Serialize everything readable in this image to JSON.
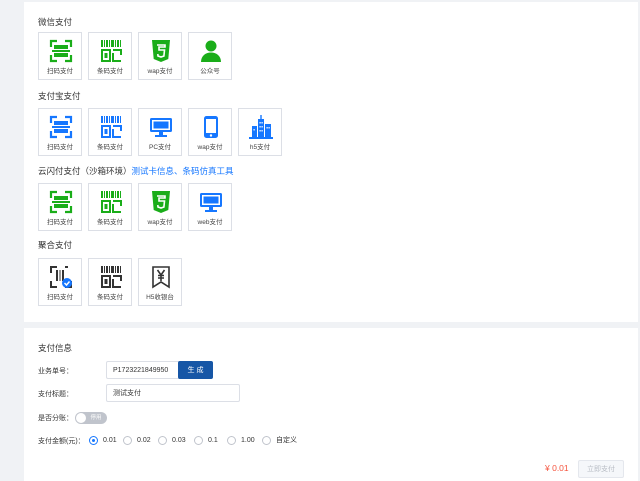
{
  "sections": {
    "wechat": {
      "title": "微信支付",
      "tiles": [
        "扫码支付",
        "条码支付",
        "wap支付",
        "公众号"
      ]
    },
    "alipay": {
      "title": "支付宝支付",
      "tiles": [
        "扫码支付",
        "条码支付",
        "PC支付",
        "wap支付",
        "h5支付"
      ]
    },
    "unionpay": {
      "title": "云闪付支付（沙箱环境）",
      "links": "测试卡信息、条码仿真工具",
      "tiles": [
        "扫码支付",
        "条码支付",
        "wap支付",
        "web支付"
      ]
    },
    "aggregate": {
      "title": "聚合支付",
      "tiles": [
        "扫码支付",
        "条码支付",
        "H5收银台"
      ]
    }
  },
  "icons": {
    "wechat": [
      "scan-icon",
      "barcode-icon",
      "html5-icon",
      "user-icon"
    ],
    "alipay": [
      "scan-icon",
      "barcode-icon",
      "monitor-icon",
      "phone-icon",
      "building-icon"
    ],
    "unionpay": [
      "scan-icon",
      "barcode-icon",
      "html5-icon",
      "monitor-icon"
    ],
    "aggregate": [
      "scan-check-icon",
      "barcode-icon",
      "yen-icon"
    ]
  },
  "colors": {
    "wechat": "#1aad19",
    "alipay": "#1677ff",
    "aggregate": "#333333",
    "price": "#f5533d",
    "primary_button": "#1656a6"
  },
  "pay_info": {
    "title": "支付信息",
    "order_label": "业务单号：",
    "order_value": "P1723221849950",
    "generate_label": "生 成",
    "subject_label": "支付标题：",
    "subject_value": "测试支付",
    "split_label": "是否分账：",
    "split_toggle": "停用",
    "amount_label": "支付金额(元)：",
    "amount_options": [
      "0.01",
      "0.02",
      "0.03",
      "0.1",
      "1.00",
      "自定义"
    ],
    "amount_selected": "0.01",
    "price": "¥ 0.01",
    "pay_button": "立即支付"
  }
}
